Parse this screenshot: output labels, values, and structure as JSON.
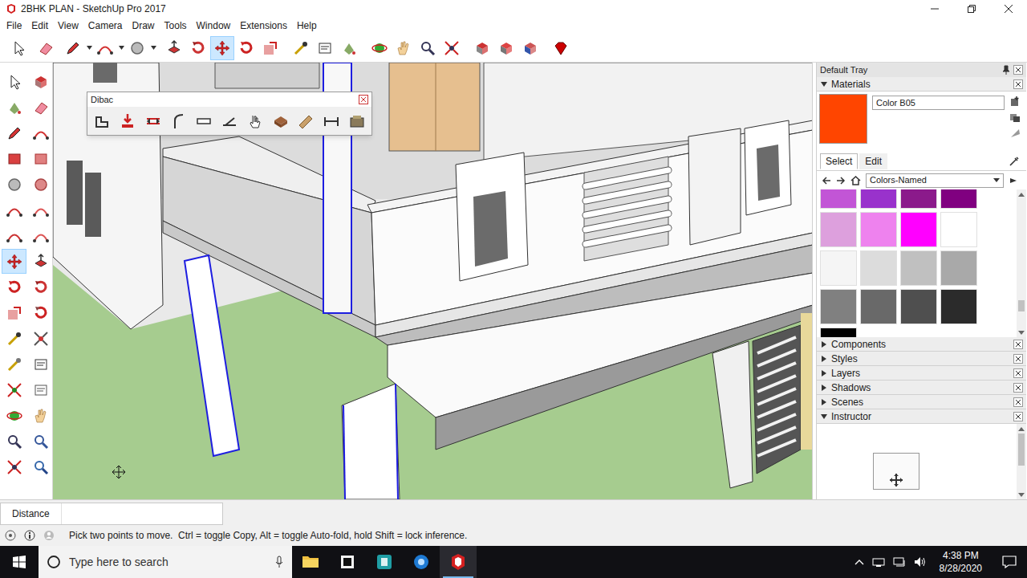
{
  "window": {
    "title": "2BHK PLAN - SketchUp Pro 2017"
  },
  "menu": [
    "File",
    "Edit",
    "View",
    "Camera",
    "Draw",
    "Tools",
    "Window",
    "Extensions",
    "Help"
  ],
  "top_tools": [
    {
      "selected": false
    },
    {
      "selected": false
    },
    {
      "selected": false
    },
    {
      "selected": false
    },
    {
      "selected": false
    },
    {
      "selected": false
    },
    {
      "selected": false
    },
    {
      "selected": true
    },
    {
      "selected": false
    },
    {
      "selected": false
    },
    {
      "selected": false
    },
    {
      "selected": false
    },
    {
      "selected": false
    },
    {
      "selected": false
    },
    {
      "selected": false
    },
    {
      "selected": false
    },
    {
      "selected": false
    },
    {
      "selected": false
    },
    {
      "selected": false
    },
    {
      "selected": false
    },
    {
      "selected": false
    }
  ],
  "left_tools": [
    {
      "selected": false
    },
    {
      "selected": false
    },
    {
      "selected": false
    },
    {
      "selected": false
    },
    {
      "selected": false
    },
    {
      "selected": false
    },
    {
      "selected": false
    },
    {
      "selected": false
    },
    {
      "selected": false
    },
    {
      "selected": false
    },
    {
      "selected": false
    },
    {
      "selected": false
    },
    {
      "selected": false
    },
    {
      "selected": false
    },
    {
      "selected": true
    },
    {
      "selected": false
    },
    {
      "selected": false
    },
    {
      "selected": false
    },
    {
      "selected": false
    },
    {
      "selected": false
    },
    {
      "selected": false
    },
    {
      "selected": false
    },
    {
      "selected": false
    },
    {
      "selected": false
    },
    {
      "selected": false
    },
    {
      "selected": false
    },
    {
      "selected": false
    },
    {
      "selected": false
    },
    {
      "selected": false
    },
    {
      "selected": false
    },
    {
      "selected": false
    },
    {
      "selected": false
    }
  ],
  "dibac": {
    "title": "Dibac"
  },
  "tray": {
    "title": "Default Tray",
    "materials": {
      "title": "Materials",
      "expanded": true,
      "current": {
        "name": "Color B05",
        "color": "#ff4500"
      },
      "tabs": [
        {
          "label": "Select",
          "selected": true
        },
        {
          "label": "Edit",
          "selected": false
        }
      ],
      "library": "Colors-Named",
      "swatches": [
        {
          "color": "#c255d6"
        },
        {
          "color": "#9932cc"
        },
        {
          "color": "#8b1a8b"
        },
        {
          "color": "#800080"
        },
        {
          "color": "#dda0dd"
        },
        {
          "color": "#ee82ee"
        },
        {
          "color": "#ff00ff"
        },
        {
          "color": "#ffffff"
        },
        {
          "color": "#f5f5f5"
        },
        {
          "color": "#dcdcdc"
        },
        {
          "color": "#c0c0c0"
        },
        {
          "color": "#a9a9a9"
        },
        {
          "color": "#808080"
        },
        {
          "color": "#696969"
        },
        {
          "color": "#4f4f4f"
        },
        {
          "color": "#2b2b2b"
        },
        {
          "color": "#000000"
        }
      ]
    },
    "panels": [
      {
        "label": "Components",
        "expanded": false
      },
      {
        "label": "Styles",
        "expanded": false
      },
      {
        "label": "Layers",
        "expanded": false
      },
      {
        "label": "Shadows",
        "expanded": false
      },
      {
        "label": "Scenes",
        "expanded": false
      },
      {
        "label": "Instructor",
        "expanded": true
      }
    ]
  },
  "measurement": {
    "label": "Distance",
    "value": ""
  },
  "status_bar": {
    "text": "Pick two points to move.  Ctrl = toggle Copy, Alt = toggle Auto-fold, hold Shift = lock inference."
  },
  "taskbar": {
    "search_placeholder": "Type here to search",
    "apps": [
      {
        "active": false
      },
      {
        "active": false
      },
      {
        "active": false
      },
      {
        "active": false
      },
      {
        "active": true
      }
    ],
    "time": "4:38 PM",
    "date": "8/28/2020"
  }
}
